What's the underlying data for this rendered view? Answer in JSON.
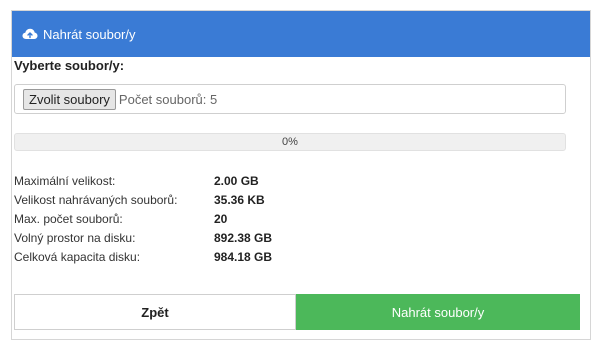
{
  "header": {
    "title": "Nahrát soubor/y",
    "icon": "cloud-upload-icon",
    "background": "#3a7bd5"
  },
  "form": {
    "select_label": "Vyberte soubor/y:",
    "choose_button": "Zvolit soubory",
    "file_count_text": "Počet souborů: 5"
  },
  "progress": {
    "value": 0,
    "label": "0%"
  },
  "info": [
    {
      "label": "Maximální velikost:",
      "value": "2.00 GB"
    },
    {
      "label": "Velikost nahrávaných souborů:",
      "value": "35.36 KB"
    },
    {
      "label": "Max. počet souborů:",
      "value": "20"
    },
    {
      "label": "Volný prostor na disku:",
      "value": "892.38 GB"
    },
    {
      "label": "Celková kapacita disku:",
      "value": "984.18 GB"
    }
  ],
  "actions": {
    "back_label": "Zpět",
    "upload_label": "Nahrát soubor/y",
    "upload_color": "#4cb85a"
  }
}
